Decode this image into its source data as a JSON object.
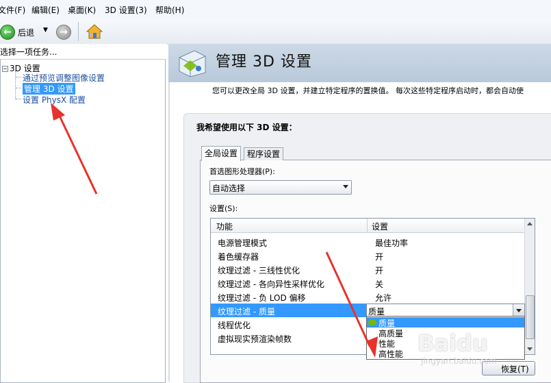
{
  "menu": [
    "文件(F)",
    "编辑(E)",
    "桌面(K)",
    "3D 设置(3)",
    "帮助(H)"
  ],
  "toolbar": {
    "back_label": "后退",
    "back_icon": "back-arrow-icon",
    "forward_icon": "forward-arrow-icon",
    "home_icon": "home-icon"
  },
  "left": {
    "task_header": "选择一项任务...",
    "tree_root": "3D 设置",
    "tree_items": [
      "通过预览调整图像设置",
      "管理 3D 设置",
      "设置 PhysX 配置"
    ],
    "selected_index": 1
  },
  "main": {
    "title": "管理 3D 设置",
    "description": "您可以更改全局 3D 设置，并建立特定程序的置换值。 每次这些特定程序启动时，都会自动使"
  },
  "panel": {
    "title": "我希望使用以下 3D 设置：",
    "tabs": [
      "全局设置",
      "程序设置"
    ],
    "active_tab": 0,
    "gpu_label": "首选图形处理器(P):",
    "gpu_value": "自动选择",
    "settings_label": "设置(S):",
    "columns": [
      "功能",
      "设置"
    ],
    "rows": [
      {
        "feature": "电源管理模式",
        "setting": "最佳功率"
      },
      {
        "feature": "着色缓存器",
        "setting": "开"
      },
      {
        "feature": "纹理过滤 - 三线性优化",
        "setting": "开"
      },
      {
        "feature": "纹理过滤 - 各向异性采样优化",
        "setting": "关"
      },
      {
        "feature": "纹理过滤 - 负 LOD 偏移",
        "setting": "允许"
      },
      {
        "feature": "纹理过滤 - 质量",
        "setting": ""
      },
      {
        "feature": "线程优化",
        "setting": ""
      },
      {
        "feature": "虚拟现实预渲染帧数",
        "setting": ""
      }
    ],
    "selected_row": 5,
    "quality_combo_value": "质量",
    "quality_options": [
      "质量",
      "高质量",
      "性能",
      "高性能"
    ],
    "quality_highlighted": 0,
    "restore_label": "恢复(T)"
  },
  "watermark": {
    "text": "Baidu",
    "sub": "jingyan.baidu.com"
  },
  "colors": {
    "selection": "#3399ff",
    "arrow": "#e8322c",
    "nvidia_green": "#76b900"
  }
}
